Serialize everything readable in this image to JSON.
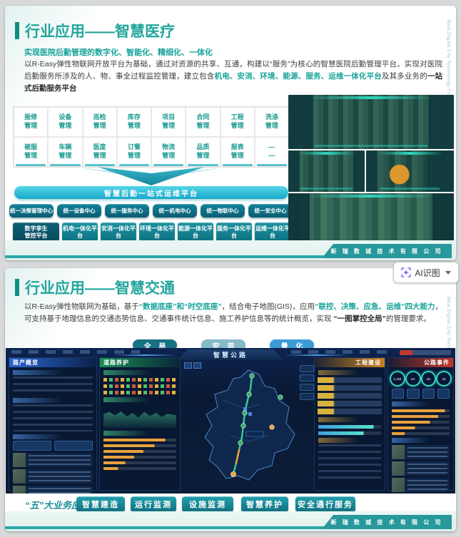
{
  "colors": {
    "accent_teal": "#1ba39b",
    "dark_teal": "#0e7c8c",
    "cyan": "#2fc3da",
    "blue": "#3d9ad8",
    "panel_blue": "#2d69dc",
    "panel_green": "#199655",
    "panel_orange": "#d7871e",
    "panel_red": "#cd3728"
  },
  "ai_tool": {
    "label": "AI识图"
  },
  "slide1": {
    "watermark": "Best Digital City Technology Co., Ltd",
    "title": "行业应用——智慧医疗",
    "subtitle": "实现医院后勤管理的数字化、智能化、精细化、一体化",
    "para": {
      "t1": "以R-Easy弹性物联网开放平台为基础，通过对资源的共享、互通，构建以“服务”为核心的智慧医院后勤管理平台。实现对医院后勤服务所涉及的人、物、事全过程监控管理，建立包含",
      "h1": "机电、安消、环境、能源、服务、运维一体化平台",
      "t2": "及其多业务的",
      "h2": "一站式后勤服务平台"
    },
    "grid1": [
      "报修\n管理",
      "设备\n管理",
      "巡检\n管理",
      "库存\n管理",
      "项目\n管理",
      "合同\n管理",
      "工程\n管理",
      "洗涤\n管理"
    ],
    "grid2": [
      "被服\n管理",
      "车辆\n管理",
      "医废\n管理",
      "订餐\n管理",
      "物流\n管理",
      "品质\n管理",
      "报表\n管理",
      "—\n—"
    ],
    "banner": "智慧后勤一站式运维平台",
    "centers": [
      "统一决策管理中心",
      "统一设备中心",
      "统一服务中心",
      "统一机电中心",
      "统一物联中心",
      "统一安全中心"
    ],
    "platforms": [
      "数字孪生\n管控平台",
      "机电一体化平台",
      "安消一体化平台",
      "环境一体化平台",
      "能源一体化平台",
      "服务一体化平台",
      "运维一体化平台"
    ],
    "company": "新 瑞 数 城 技 术 有 限 公 司"
  },
  "slide2": {
    "watermark": "Best Digital City Technology Co., Ltd",
    "title": "行业应用——智慧交通",
    "para": {
      "t1": "以R-Easy弹性物联网为基础，基于",
      "h1": "“数据底座”和“时空底座”",
      "t2": "，结合电子地图(GIS)，应用",
      "h2": "“联控、决策、应急、运维”四大能力",
      "t3": "，可支持基于地理信息的交通态势信息、交通事件统计信息、施工养护信息等的统计概览，实现 ",
      "h3": "“一图掌控全局”",
      "t4": "的管理要求。"
    },
    "view_buttons": [
      "全 局",
      "宏 观",
      "量 化"
    ],
    "dashboard": {
      "title": "智慧公路",
      "panel1": "路产概览",
      "panel2": "道路养护",
      "panel3": "工程建设",
      "panel4": "公路事件",
      "gauges": [
        "4,184",
        "54",
        "28",
        "22"
      ]
    },
    "biz_label": "“五”大业务应用",
    "biz_buttons": [
      "智慧建造",
      "运行监测",
      "设施监测",
      "智慧养护",
      "安全通行服务"
    ],
    "company": "新 瑞 数 城 技 术 有 限 公 司"
  }
}
